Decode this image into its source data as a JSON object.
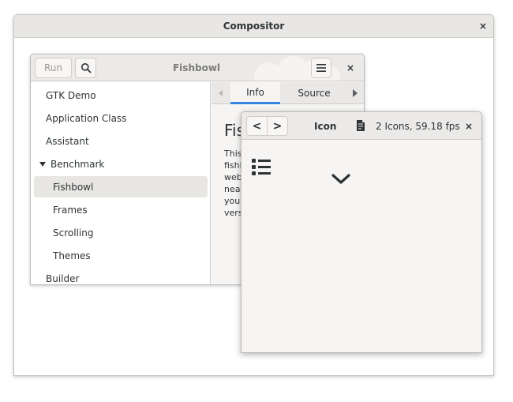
{
  "compositor": {
    "title": "Compositor",
    "close": "×"
  },
  "fishbowl": {
    "title": "Fishbowl",
    "run_label": "Run",
    "close": "×",
    "sidebar": [
      {
        "label": "GTK Demo"
      },
      {
        "label": "Application Class"
      },
      {
        "label": "Assistant"
      },
      {
        "label": "Benchmark",
        "expanded": true
      },
      {
        "label": "Fishbowl",
        "selected": true
      },
      {
        "label": "Frames"
      },
      {
        "label": "Scrolling"
      },
      {
        "label": "Themes"
      },
      {
        "label": "Builder"
      }
    ],
    "tabs": [
      {
        "label": "Info",
        "active": true
      },
      {
        "label": "Source"
      }
    ],
    "info": {
      "heading": "Fis",
      "lines": [
        "This",
        "fishb",
        "web",
        "neat",
        "your",
        "versi"
      ]
    }
  },
  "icon_window": {
    "title": "Icon",
    "stats": "2 Icons, 59.18 fps",
    "close": "×",
    "back": "<",
    "forward": ">"
  },
  "colors": {
    "accent": "#3584e4",
    "header_bg": "#ebeae8",
    "selection_bg": "#e8e6e3"
  }
}
